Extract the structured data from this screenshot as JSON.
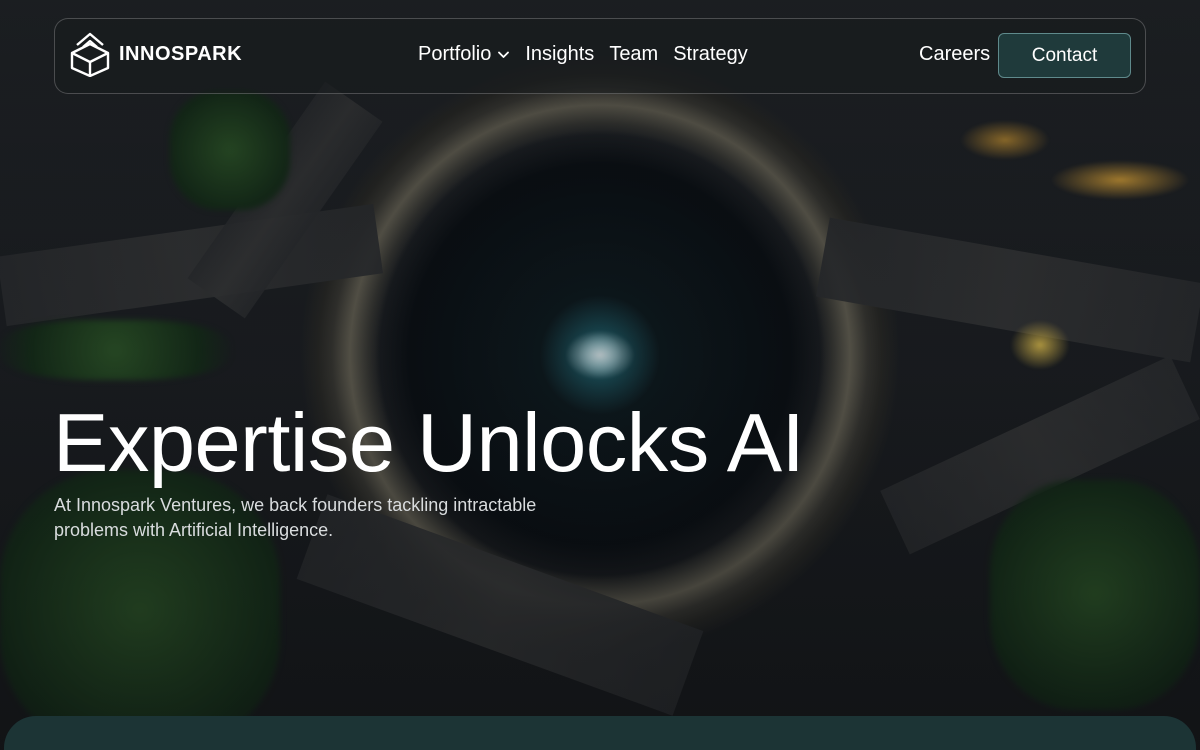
{
  "brand": {
    "name": "INNOSPARK",
    "logo_icon": "open-box-icon"
  },
  "nav": {
    "items": [
      {
        "label": "Portfolio",
        "has_dropdown": true
      },
      {
        "label": "Insights"
      },
      {
        "label": "Team"
      },
      {
        "label": "Strategy"
      }
    ],
    "careers_label": "Careers",
    "contact_label": "Contact"
  },
  "hero": {
    "title": "Expertise Unlocks AI",
    "subtitle": "At Innospark Ventures, we back founders tackling intractable problems with Artificial Intelligence."
  },
  "colors": {
    "contact_bg": "#1f3a3b",
    "bottom_panel": "#1c3435",
    "text": "#ffffff"
  }
}
